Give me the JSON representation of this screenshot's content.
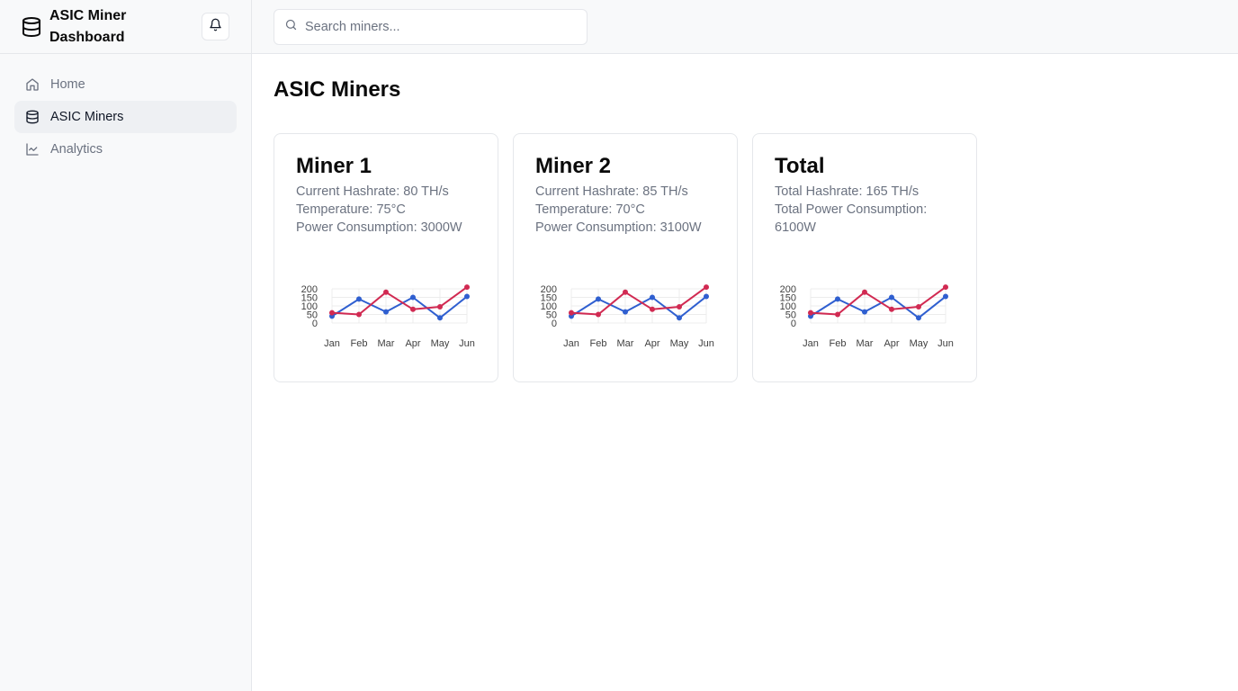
{
  "sidebar": {
    "title": "ASIC Miner Dashboard",
    "items": [
      {
        "label": "Home",
        "icon": "home-icon"
      },
      {
        "label": "ASIC Miners",
        "icon": "database-icon",
        "active": true
      },
      {
        "label": "Analytics",
        "icon": "line-chart-icon"
      }
    ]
  },
  "search": {
    "placeholder": "Search miners..."
  },
  "main": {
    "title": "ASIC Miners",
    "cards": [
      {
        "title": "Miner 1",
        "lines": [
          "Current Hashrate: 80 TH/s",
          "Temperature: 75°C",
          "Power Consumption: 3000W"
        ]
      },
      {
        "title": "Miner 2",
        "lines": [
          "Current Hashrate: 85 TH/s",
          "Temperature: 70°C",
          "Power Consumption: 3100W"
        ]
      },
      {
        "title": "Total",
        "lines": [
          "Total Hashrate: 165 TH/s",
          "Total Power Consumption: 6100W"
        ]
      }
    ]
  },
  "colors": {
    "series_a": "#2f5fd0",
    "series_b": "#d12a52",
    "grid": "#ececec"
  },
  "chart_data": [
    {
      "type": "line",
      "categories": [
        "Jan",
        "Feb",
        "Mar",
        "Apr",
        "May",
        "Jun"
      ],
      "yticks": [
        "0",
        "50",
        "100",
        "150",
        "200"
      ],
      "ylim": [
        0,
        200
      ],
      "grid": true,
      "series": [
        {
          "values": [
            40,
            140,
            65,
            150,
            30,
            155
          ]
        },
        {
          "values": [
            60,
            50,
            180,
            80,
            95,
            210
          ]
        }
      ]
    },
    {
      "type": "line",
      "categories": [
        "Jan",
        "Feb",
        "Mar",
        "Apr",
        "May",
        "Jun"
      ],
      "yticks": [
        "0",
        "50",
        "100",
        "150",
        "200"
      ],
      "ylim": [
        0,
        200
      ],
      "grid": true,
      "series": [
        {
          "values": [
            40,
            140,
            65,
            150,
            30,
            155
          ]
        },
        {
          "values": [
            60,
            50,
            180,
            80,
            95,
            210
          ]
        }
      ]
    },
    {
      "type": "line",
      "categories": [
        "Jan",
        "Feb",
        "Mar",
        "Apr",
        "May",
        "Jun"
      ],
      "yticks": [
        "0",
        "50",
        "100",
        "150",
        "200"
      ],
      "ylim": [
        0,
        200
      ],
      "grid": true,
      "series": [
        {
          "values": [
            40,
            140,
            65,
            150,
            30,
            155
          ]
        },
        {
          "values": [
            60,
            50,
            180,
            80,
            95,
            210
          ]
        }
      ]
    }
  ]
}
